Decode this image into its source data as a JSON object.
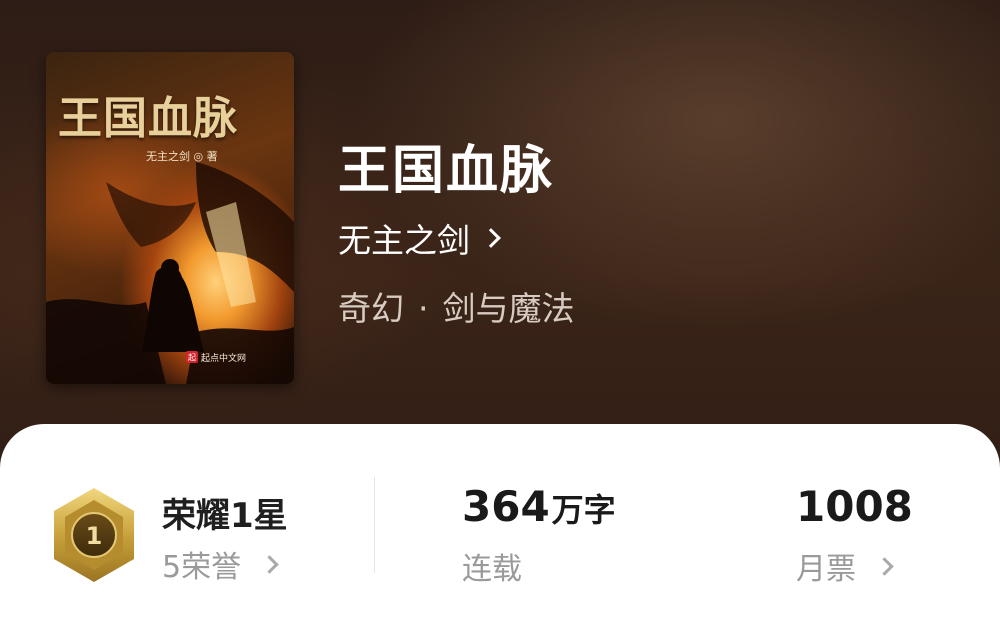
{
  "book": {
    "title": "王国血脉",
    "author": "无主之剑",
    "genre_primary": "奇幻",
    "genre_separator": "·",
    "genre_secondary": "剑与魔法"
  },
  "cover": {
    "title_text": "王国血脉",
    "author_text": "无主之剑 ◎ 著",
    "publisher_text": "起点中文网"
  },
  "stats": {
    "honor_level": "荣耀1星",
    "honor_count": "5荣誉",
    "badge_number": "1",
    "word_count": "364",
    "word_unit": "万字",
    "status": "连载",
    "monthly_tickets": "1008",
    "tickets_label": "月票"
  },
  "colors": {
    "badge_gold": "#c9a23c",
    "badge_dark": "#5b4215"
  },
  "icons": {
    "author_chevron": "chevron-right-icon",
    "honor_chevron": "chevron-right-icon",
    "tickets_chevron": "chevron-right-icon",
    "badge": "honor-badge-icon"
  }
}
